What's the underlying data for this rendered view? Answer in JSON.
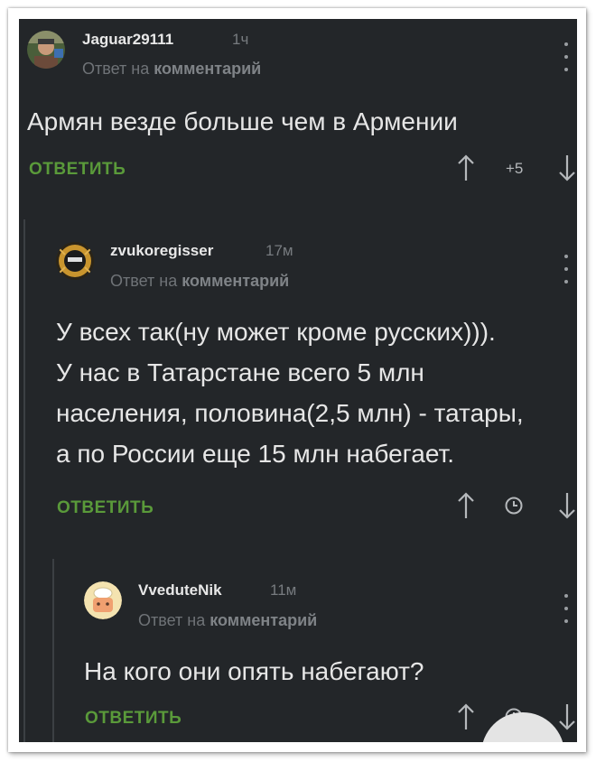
{
  "comments": [
    {
      "username": "Jaguar29111",
      "time": "1ч",
      "reply_prefix": "Ответ на",
      "reply_target": "комментарий",
      "text": [
        "Армян везде больше чем в Армении"
      ],
      "reply_label": "ОТВЕТИТЬ",
      "rating": "+5"
    },
    {
      "username": "zvukoregisser",
      "time": "17м",
      "reply_prefix": "Ответ на",
      "reply_target": "комментарий",
      "text": [
        "У всех так(ну может кроме русских))).",
        "У нас в Татарстане всего 5 млн",
        "населения, половина(2,5 млн) - татары,",
        "а по России еще 15 млн набегает."
      ],
      "reply_label": "ОТВЕТИТЬ",
      "rating_icon": "clock-icon"
    },
    {
      "username": "VveduteNik",
      "time": "11м",
      "reply_prefix": "Ответ на",
      "reply_target": "комментарий",
      "text": [
        "На кого они опять набегают?"
      ],
      "reply_label": "ОТВЕТИТЬ",
      "rating_icon": "clock-icon"
    }
  ],
  "colors": {
    "background": "#232629",
    "accent_green": "#5a9a3a",
    "text": "#e6e6e6",
    "muted": "#777b7f"
  }
}
